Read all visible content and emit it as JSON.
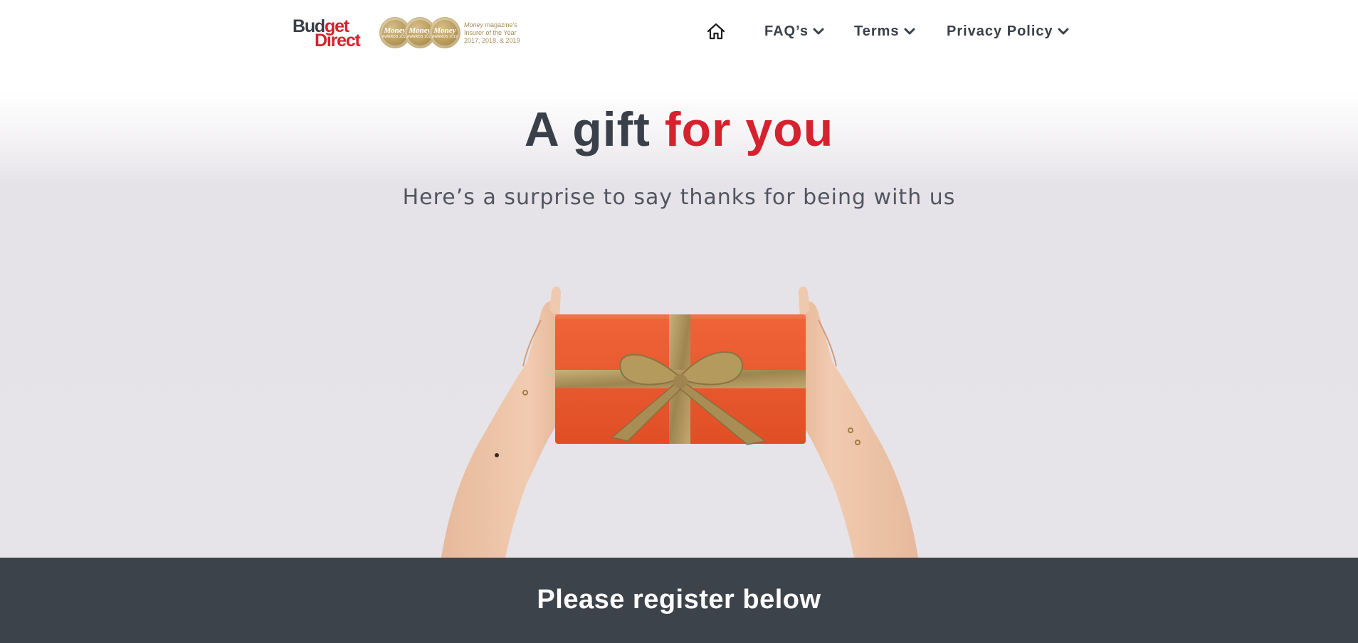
{
  "header": {
    "brand": {
      "line1_dark": "Bud",
      "line1_red": "get",
      "line2": "Direct"
    },
    "awards": {
      "medals": [
        {
          "name": "Money",
          "sub": "AWARDS 2017"
        },
        {
          "name": "Money",
          "sub": "AWARDS 2018"
        },
        {
          "name": "Money",
          "sub": "AWARDS 2019"
        }
      ],
      "caption_italic": "Money",
      "caption_line1_rest": " magazine's",
      "caption_line2": "Insurer of the Year",
      "caption_line3": "2017, 2018, & 2019"
    },
    "nav": {
      "home_icon": "home-icon",
      "items": [
        {
          "label": "FAQ’s"
        },
        {
          "label": "Terms"
        },
        {
          "label": "Privacy Policy"
        }
      ]
    }
  },
  "hero": {
    "title_plain": "A gift ",
    "title_accent": "for you",
    "subtitle": "Here’s a surprise to say thanks for being with us",
    "image": "hands-holding-gift-box"
  },
  "register": {
    "title": "Please register below"
  },
  "colors": {
    "brand_red": "#d5222e",
    "dark_text": "#3a4049",
    "register_bar": "#3d434b",
    "gift_orange": "#ee5a2c",
    "ribbon_gold": "#b49a5c"
  }
}
